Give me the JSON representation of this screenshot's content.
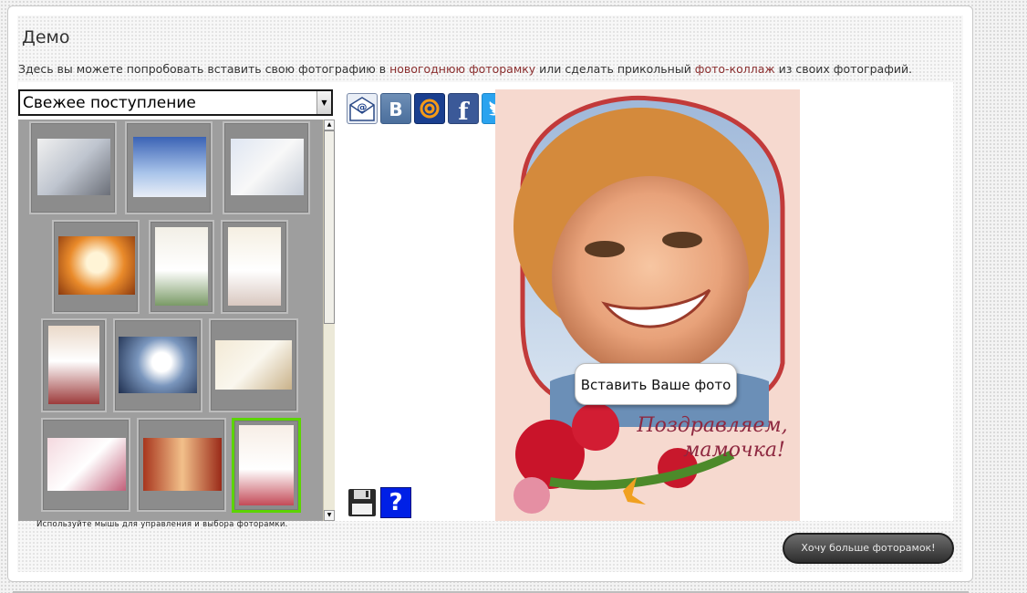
{
  "page": {
    "title": "Демо",
    "intro_before": "Здесь вы можете попробовать вставить свою фотографию в ",
    "intro_link1": "новогоднюю фоторамку",
    "intro_middle": " или сделать прикольный ",
    "intro_link2": "фото-коллаж",
    "intro_after": " из своих фотографий."
  },
  "category_select": {
    "selected": "Свежее поступление"
  },
  "gallery": {
    "thumb_count": 12,
    "selected_index": 12,
    "hint": "Используйте мышь для управления и выбора фоторамки."
  },
  "share_icons": [
    "email-icon",
    "vk-icon",
    "mailru-icon",
    "facebook-icon",
    "twitter-icon"
  ],
  "share_labels": {
    "vk": "В",
    "facebook": "f"
  },
  "tools": {
    "save": "save-icon",
    "help_label": "?"
  },
  "preview": {
    "insert_button": "Вставить Ваше фото",
    "caption": "Поздравляем, мамочка!"
  },
  "more_button": "Хочу больше фоторамок!",
  "colors": {
    "link": "#8b2f2f",
    "selected_border": "#5cd400",
    "button_dark": "#2e2e2e"
  }
}
